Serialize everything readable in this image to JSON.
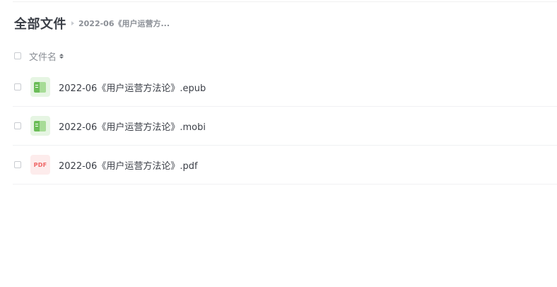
{
  "breadcrumb": {
    "root": "全部文件",
    "current": "2022-06《用户运营方..."
  },
  "list_header": {
    "name_column": "文件名"
  },
  "files": [
    {
      "name": "2022-06《用户运营方法论》.epub",
      "icon": "ebook-icon",
      "icon_color": "#6bbd58"
    },
    {
      "name": "2022-06《用户运营方法论》.mobi",
      "icon": "ebook-icon",
      "icon_color": "#6bbd58"
    },
    {
      "name": "2022-06《用户运营方法论》.pdf",
      "icon": "pdf-icon",
      "icon_color": "#ef6464",
      "icon_text": "PDF"
    }
  ]
}
